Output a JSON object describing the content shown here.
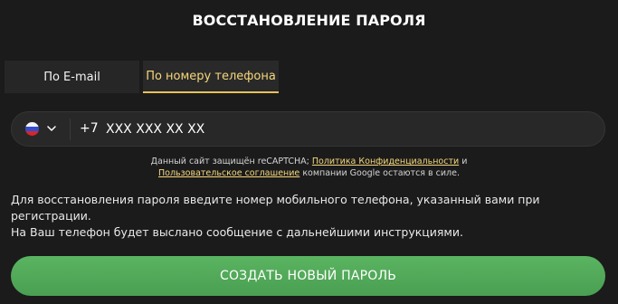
{
  "page": {
    "title": "ВОССТАНОВЛЕНИЕ ПАРОЛЯ"
  },
  "tabs": [
    {
      "label": "По E-mail",
      "active": false
    },
    {
      "label": "По номеру телефона",
      "active": true
    }
  ],
  "phone": {
    "country_icon": "flag-ru-icon",
    "country_code": "+7",
    "placeholder": "XXX XXX XX XX",
    "value": ""
  },
  "recaptcha": {
    "prefix": "Данный сайт защищён reCAPTCHA;",
    "privacy_link": "Политика Конфиденциальности",
    "and": "и",
    "terms_link": "Пользовательское соглашение",
    "suffix": "компании Google остаются в силе."
  },
  "info": {
    "line1": "Для восстановления пароля введите номер мобильного телефона, указанный вами при регистрации.",
    "line2": "На Ваш телефон будет выслано сообщение с дальнейшими инструкциями."
  },
  "submit": {
    "label": "СОЗДАТЬ НОВЫЙ ПАРОЛЬ"
  },
  "colors": {
    "background": "#1b1b1b",
    "accent": "#f5d77b",
    "button": "#52aa5a"
  }
}
